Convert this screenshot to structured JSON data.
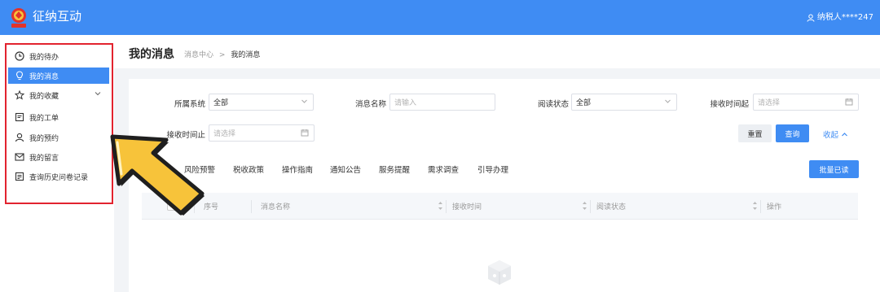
{
  "header": {
    "app_title": "征纳互动",
    "user_label": "纳税人****247"
  },
  "sidebar": {
    "items": [
      {
        "label": "我的待办",
        "icon": "clock-icon"
      },
      {
        "label": "我的消息",
        "icon": "lightbulb-icon"
      },
      {
        "label": "我的收藏",
        "icon": "star-icon"
      },
      {
        "label": "我的工单",
        "icon": "document-icon"
      },
      {
        "label": "我的预约",
        "icon": "user-icon"
      },
      {
        "label": "我的留言",
        "icon": "mail-icon"
      },
      {
        "label": "查询历史问卷记录",
        "icon": "list-icon"
      }
    ]
  },
  "page": {
    "title": "我的消息",
    "breadcrumb_parent": "消息中心",
    "breadcrumb_sep": ">",
    "breadcrumb_current": "我的消息"
  },
  "filters": {
    "system_label": "所属系统",
    "system_value": "全部",
    "name_label": "消息名称",
    "name_placeholder": "请输入",
    "read_label": "阅读状态",
    "read_value": "全部",
    "time_start_label": "接收时间起",
    "time_start_placeholder": "请选择",
    "time_end_label": "接收时间止",
    "time_end_placeholder": "请选择"
  },
  "actions": {
    "reset": "重置",
    "search": "查询",
    "collapse": "收起",
    "batch_read": "批量已读"
  },
  "tabs": [
    "风险预警",
    "税收政策",
    "操作指南",
    "通知公告",
    "服务提醒",
    "需求调查",
    "引导办理"
  ],
  "table": {
    "columns": [
      "序号",
      "消息名称",
      "接收时间",
      "阅读状态",
      "操作"
    ]
  },
  "colors": {
    "primary": "#3f8cf3",
    "highlight_frame": "#e2232f",
    "pointer_fill": "#f7c33a"
  }
}
